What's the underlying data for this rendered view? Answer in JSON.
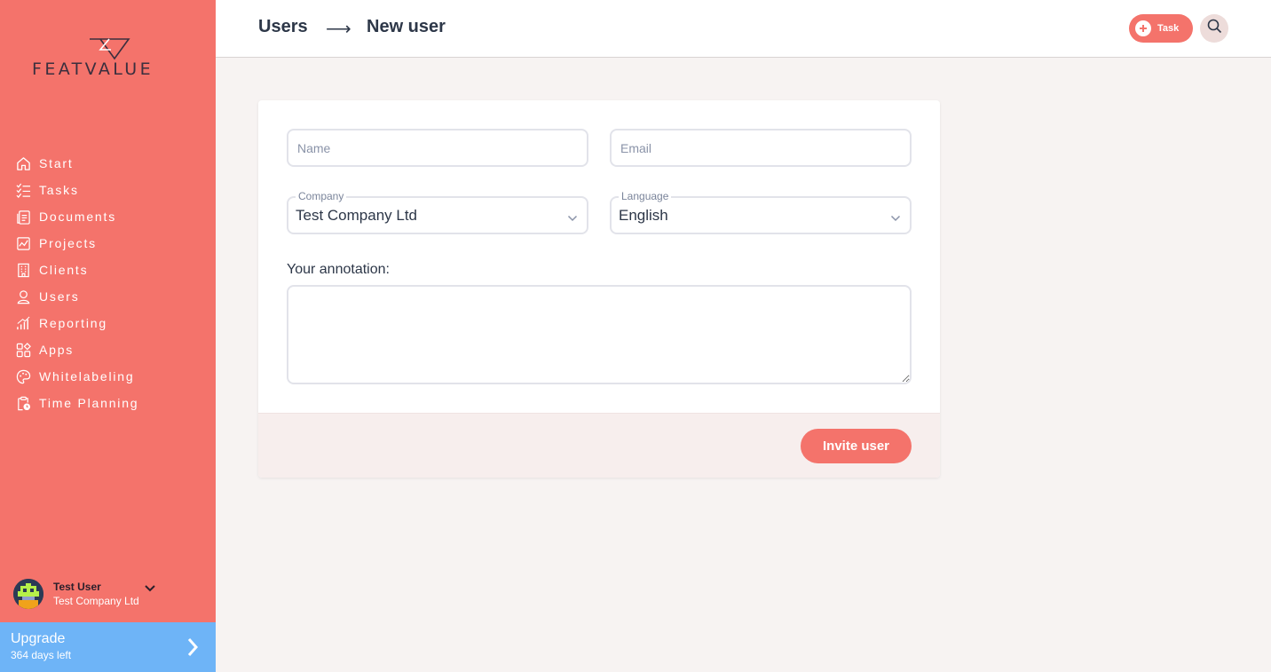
{
  "brand": {
    "name": "FEATVALUE",
    "accent": "#f4736b",
    "upgrade_color": "#6eb4f7"
  },
  "sidebar": {
    "items": [
      {
        "label": "Start",
        "icon": "home-icon"
      },
      {
        "label": "Tasks",
        "icon": "checklist-icon"
      },
      {
        "label": "Documents",
        "icon": "document-icon"
      },
      {
        "label": "Projects",
        "icon": "chart-icon"
      },
      {
        "label": "Clients",
        "icon": "building-icon"
      },
      {
        "label": "Users",
        "icon": "user-icon"
      },
      {
        "label": "Reporting",
        "icon": "bar-chart-icon"
      },
      {
        "label": "Apps",
        "icon": "apps-icon"
      },
      {
        "label": "Whitelabeling",
        "icon": "palette-icon"
      },
      {
        "label": "Time Planning",
        "icon": "clipboard-clock-icon"
      }
    ],
    "user": {
      "name": "Test User",
      "company": "Test Company Ltd"
    },
    "upgrade": {
      "title": "Upgrade",
      "subtitle": "364 days left"
    }
  },
  "header": {
    "breadcrumb": [
      "Users",
      "New user"
    ],
    "arrow": "⟶",
    "task_button": "Task"
  },
  "form": {
    "name_placeholder": "Name",
    "email_placeholder": "Email",
    "company": {
      "label": "Company",
      "value": "Test Company Ltd"
    },
    "language": {
      "label": "Language",
      "value": "English"
    },
    "annotation_label": "Your annotation:",
    "submit": "Invite user"
  }
}
